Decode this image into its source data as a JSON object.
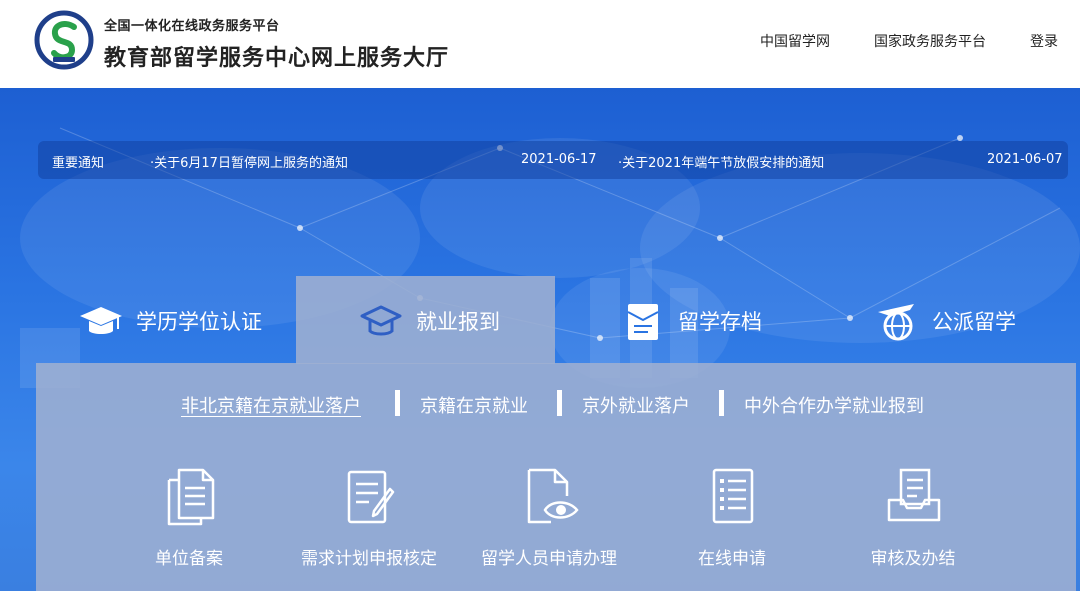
{
  "header": {
    "platform_name": "全国一体化在线政务服务平台",
    "site_title": "教育部留学服务中心网上服务大厅",
    "nav": [
      "中国留学网",
      "国家政务服务平台",
      "登录"
    ]
  },
  "notice": {
    "label": "重要通知",
    "items": [
      {
        "title": "·关于6月17日暂停网上服务的通知",
        "date": "2021-06-17"
      },
      {
        "title": "·关于2021年端午节放假安排的通知",
        "date": "2021-06-07"
      }
    ]
  },
  "tabs": [
    {
      "label": "学历学位认证",
      "icon": "graduation-cap-icon"
    },
    {
      "label": "就业报到",
      "icon": "employment-hat-icon",
      "active": true
    },
    {
      "label": "留学存档",
      "icon": "archive-document-icon"
    },
    {
      "label": "公派留学",
      "icon": "airplane-globe-icon"
    }
  ],
  "subnav": [
    "非北京籍在京就业落户",
    "京籍在京就业",
    "京外就业落户",
    "中外合作办学就业报到"
  ],
  "services": [
    {
      "label": "单位备案",
      "icon": "documents-icon"
    },
    {
      "label": "需求计划申报核定",
      "icon": "edit-form-icon"
    },
    {
      "label": "留学人员申请办理",
      "icon": "document-eye-icon"
    },
    {
      "label": "在线申请",
      "icon": "checklist-icon"
    },
    {
      "label": "审核及办结",
      "icon": "inbox-tray-icon"
    }
  ],
  "colors": {
    "hero_blue": "#2a74e2",
    "panel_grey_blue": "#9eafd2",
    "text_white": "#ffffff"
  }
}
